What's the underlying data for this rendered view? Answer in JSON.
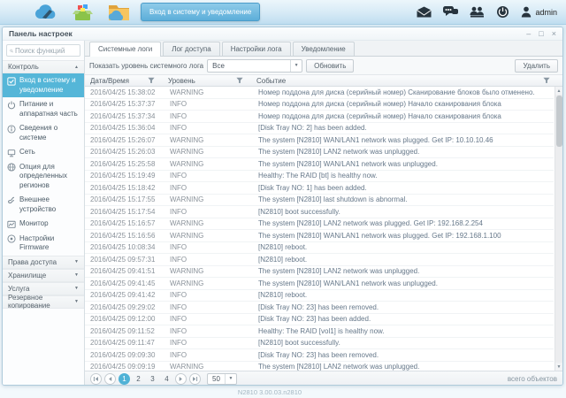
{
  "taskbar": {
    "active_task": "Вход в систему и уведомление",
    "user": "admin"
  },
  "window": {
    "title": "Панель настроек",
    "controls": {
      "minimize": "–",
      "maximize": "□",
      "close": "×"
    }
  },
  "sidebar": {
    "search_placeholder": "Поиск функций",
    "sections": [
      {
        "label": "Контроль",
        "expanded": true,
        "items": [
          {
            "icon": "login-notify-icon",
            "label": "Вход в систему и уведомление",
            "active": true
          },
          {
            "icon": "power-icon",
            "label": "Питание и аппаратная часть"
          },
          {
            "icon": "info-icon",
            "label": "Сведения о системе"
          },
          {
            "icon": "network-icon",
            "label": "Сеть"
          },
          {
            "icon": "globe-icon",
            "label": "Опция для определенных регионов"
          },
          {
            "icon": "usb-icon",
            "label": "Внешнее устройство"
          },
          {
            "icon": "monitor-chart-icon",
            "label": "Монитор"
          },
          {
            "icon": "firmware-icon",
            "label": "Настройки Firmware"
          }
        ]
      },
      {
        "label": "Права доступа",
        "expanded": false
      },
      {
        "label": "Хранилище",
        "expanded": false
      },
      {
        "label": "Услуга",
        "expanded": false
      },
      {
        "label": "Резервное копирование",
        "expanded": false
      }
    ]
  },
  "main": {
    "tabs": [
      {
        "label": "Системные логи",
        "active": true
      },
      {
        "label": "Лог доступа"
      },
      {
        "label": "Настройки лога"
      },
      {
        "label": "Уведомление"
      }
    ],
    "toolbar": {
      "filter_label": "Показать уровень системного лога",
      "filter_value": "Все",
      "refresh_label": "Обновить",
      "delete_label": "Удалить"
    },
    "table": {
      "columns": [
        "Дата/Время",
        "Уровень",
        "Событие"
      ],
      "rows": [
        {
          "time": "2016/04/25 15:38:02",
          "level": "WARNING",
          "event": "Номер поддона для диска (серийный номер) Сканирование блоков было отменено."
        },
        {
          "time": "2016/04/25 15:37:37",
          "level": "INFO",
          "event": "Номер поддона для диска (серийный номер) Начало сканирования блока"
        },
        {
          "time": "2016/04/25 15:37:34",
          "level": "INFO",
          "event": "Номер поддона для диска (серийный номер) Начало сканирования блока"
        },
        {
          "time": "2016/04/25 15:36:04",
          "level": "INFO",
          "event": "[Disk Tray NO: 2] has been added."
        },
        {
          "time": "2016/04/25 15:26:07",
          "level": "WARNING",
          "event": "The system [N2810] WAN/LAN1 network was plugged. Get IP: 10.10.10.46"
        },
        {
          "time": "2016/04/25 15:26:03",
          "level": "WARNING",
          "event": "The system [N2810] LAN2 network was unplugged."
        },
        {
          "time": "2016/04/25 15:25:58",
          "level": "WARNING",
          "event": "The system [N2810] WAN/LAN1 network was unplugged."
        },
        {
          "time": "2016/04/25 15:19:49",
          "level": "INFO",
          "event": "Healthy: The RAID [bt] is healthy now."
        },
        {
          "time": "2016/04/25 15:18:42",
          "level": "INFO",
          "event": "[Disk Tray NO: 1] has been added."
        },
        {
          "time": "2016/04/25 15:17:55",
          "level": "WARNING",
          "event": "The system [N2810] last shutdown is abnormal."
        },
        {
          "time": "2016/04/25 15:17:54",
          "level": "INFO",
          "event": "[N2810] boot successfully."
        },
        {
          "time": "2016/04/25 15:16:57",
          "level": "WARNING",
          "event": "The system [N2810] LAN2 network was plugged. Get IP: 192.168.2.254"
        },
        {
          "time": "2016/04/25 15:16:56",
          "level": "WARNING",
          "event": "The system [N2810] WAN/LAN1 network was plugged. Get IP: 192.168.1.100"
        },
        {
          "time": "2016/04/25 10:08:34",
          "level": "INFO",
          "event": "[N2810] reboot."
        },
        {
          "time": "2016/04/25 09:57:31",
          "level": "INFO",
          "event": "[N2810] reboot."
        },
        {
          "time": "2016/04/25 09:41:51",
          "level": "WARNING",
          "event": "The system [N2810] LAN2 network was unplugged."
        },
        {
          "time": "2016/04/25 09:41:45",
          "level": "WARNING",
          "event": "The system [N2810] WAN/LAN1 network was unplugged."
        },
        {
          "time": "2016/04/25 09:41:42",
          "level": "INFO",
          "event": "[N2810] reboot."
        },
        {
          "time": "2016/04/25 09:29:02",
          "level": "INFO",
          "event": "[Disk Tray NO: 23] has been removed."
        },
        {
          "time": "2016/04/25 09:12:00",
          "level": "INFO",
          "event": "[Disk Tray NO: 23] has been added."
        },
        {
          "time": "2016/04/25 09:11:52",
          "level": "INFO",
          "event": "Healthy: The RAID [vol1] is healthy now."
        },
        {
          "time": "2016/04/25 09:11:47",
          "level": "INFO",
          "event": "[N2810] boot successfully."
        },
        {
          "time": "2016/04/25 09:09:30",
          "level": "INFO",
          "event": "[Disk Tray NO: 23] has been removed."
        },
        {
          "time": "2016/04/25 09:09:19",
          "level": "WARNING",
          "event": "The system [N2810] LAN2 network was unplugged."
        }
      ]
    },
    "pagination": {
      "pages": [
        "1",
        "2",
        "3",
        "4"
      ],
      "current": "1",
      "page_size": "50",
      "total_label": "всего объектов"
    }
  },
  "footer": "N2810  3.00.03.n2810",
  "colors": {
    "accent": "#55b6d8",
    "taskbar_button": "#5caed9"
  }
}
